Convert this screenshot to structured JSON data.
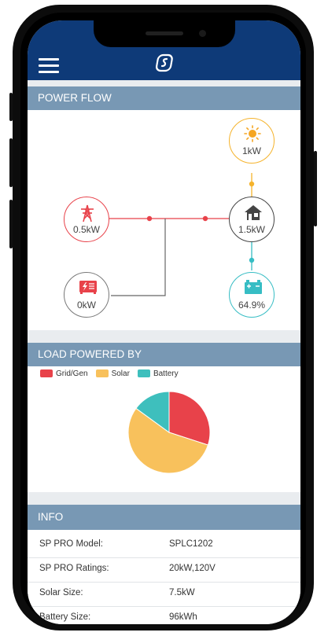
{
  "app": {
    "logo_icon": "sunpower-s-logo",
    "menu_icon": "hamburger-icon",
    "brand_color": "#0e3a78",
    "header_color": "#7898b4"
  },
  "power_flow": {
    "title": "POWER FLOW",
    "solar": {
      "value": "1kW",
      "icon": "sun-icon",
      "color": "#f5b32c"
    },
    "grid": {
      "value": "0.5kW",
      "icon": "power-tower-icon",
      "color": "#e8424a"
    },
    "home": {
      "value": "1.5kW",
      "icon": "house-icon",
      "color": "#444444"
    },
    "generator": {
      "value": "0kW",
      "icon": "generator-icon",
      "color": "#777777"
    },
    "battery": {
      "value": "64.9%",
      "icon": "battery-icon",
      "color": "#36bdc4"
    }
  },
  "load": {
    "title": "LOAD POWERED BY",
    "legend": [
      {
        "label": "Grid/Gen",
        "color": "#e8424a"
      },
      {
        "label": "Solar",
        "color": "#f8c15c"
      },
      {
        "label": "Battery",
        "color": "#3ebfbd"
      }
    ]
  },
  "chart_data": {
    "type": "pie",
    "categories": [
      "Grid/Gen",
      "Solar",
      "Battery"
    ],
    "values": [
      0.3,
      0.55,
      0.15
    ],
    "colors": [
      "#e8424a",
      "#f8c15c",
      "#3ebfbd"
    ]
  },
  "info": {
    "title": "INFO",
    "rows": [
      {
        "label": "SP PRO Model:",
        "value": "SPLC1202"
      },
      {
        "label": "SP PRO Ratings:",
        "value": "20kW,120V"
      },
      {
        "label": "Solar Size:",
        "value": "7.5kW"
      },
      {
        "label": "Battery Size:",
        "value": "96kWh"
      }
    ]
  }
}
